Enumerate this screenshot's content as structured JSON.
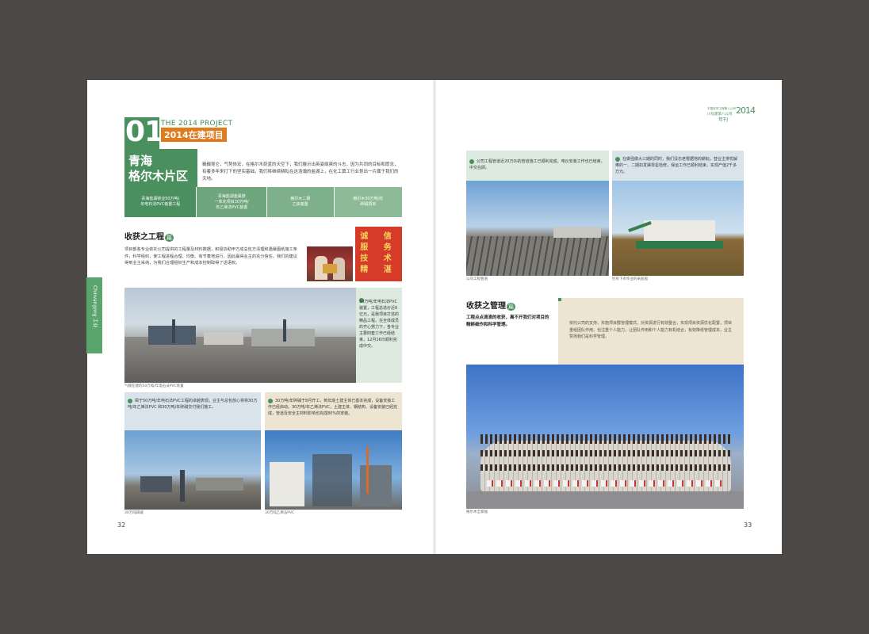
{
  "left_page": {
    "section_number": "01",
    "section_en": "THE 2014 PROJECT",
    "section_title": "2014在建项目",
    "region_title_1": "青海",
    "region_title_2": "格尔木片区",
    "intro": "巍巍昆仑，气势恢宏，在格尔木蔚蓝的天空下，我们展示出英姿飒爽的斗志，因为共同的目标和愿念，有着多年来打下的坚实基础，我们将继续耕耘在这浩瀚的盐湖上，在化工奠工行业划出一片属于我们的天地。",
    "tabs": [
      "青海盐湖镁业50万吨/\n年电石法PVC装置工程",
      "青海盐湖金属镁\n一体化项目30万吨/\n年乙烯法PVC装置",
      "格尔木二期\n乙炔装置",
      "格尔木30万吨/年\n碎碱项目"
    ],
    "harvest_title": "收获之工程",
    "harvest_badge": "篇",
    "harvest_text": "项目部各专业依托公司提供的工程量及材料数据，积极协助甲方成总包方清理和遇暴图纸施工条件，科学组织，使工程进程合理、均衡、有节奏地进行，因此赢得业主的充分信任，我们的建议得到业主采纳，为我们合理组织生产和成本控制取得了话语权。",
    "banner_text": "诚 信 服 务 技 术 精 湛",
    "side_info": "50万吨/年电石法PVC装置，工程总造价近8亿元，是我项目打造的精品工程，在全体成员的齐心努力下，各专业主要四套工作已经结束，12月16日顺利完成中交。",
    "main_caption": "气膜在建的50万吨/年电石法PVC装置",
    "box1_text": "凿于50万吨/年电石法PVC工程的卓越表现，业主与总包放心将将30万吨/年乙烯法PVC 和30万吨/年碎碱交付我们施工。",
    "box2_text": "30万吨/年碎碱于8月开工，到年底土建主体已基本完成，设备安装工作已经启动。30万吨/年乙烯法PVC，土建主体、钢结构、设备安装已经完成，管道及安全主材料影响也完成80%的安装。",
    "cap1": "30万吨碎碱",
    "cap2": "30万吨乙烯法PVC",
    "side_tab": "Chinvangong 工业",
    "page_number": "32"
  },
  "right_page": {
    "header_label_small": "中国化学工程第八公司",
    "header_label": "川化建第八公司",
    "header_year": "2014",
    "header_annual": "年刊",
    "top_box1": "公司工程管道近20万Di的管道施工已顺利完成，电仪安装工作也已结束，中交在即。",
    "top_box2": "在做强做大三期的同时，我们没忘老根据地的耕耘，替业主排忧解难的一、二期扣发屠零星检修，保运工作已顺利结束，实现产值2千多万元。",
    "photo_cap1": "公司工程管道",
    "photo_cap2": "挖有下水作业的采盐船",
    "mgmt_title": "收获之管理",
    "mgmt_badge": "篇",
    "mgmt_lead": "工程点点滴滴的收获，离不开我们对项目的精耕细作和科学管理。",
    "mgmt_text": "依托公司的支持，实施项目群管理模式，对资源进行有效整合，实现项目资源优化配置，项目重组团队作用，也注重个人能力，让团队作用和个人能力有机结合，有效降低管理成本，业主赞扬我们是科学管理。",
    "group_caption": "格尔木全家福",
    "page_number": "33"
  },
  "colors": {
    "accent_green": "#4a8f5e",
    "accent_orange": "#e07b1d",
    "background": "#4b4846"
  }
}
